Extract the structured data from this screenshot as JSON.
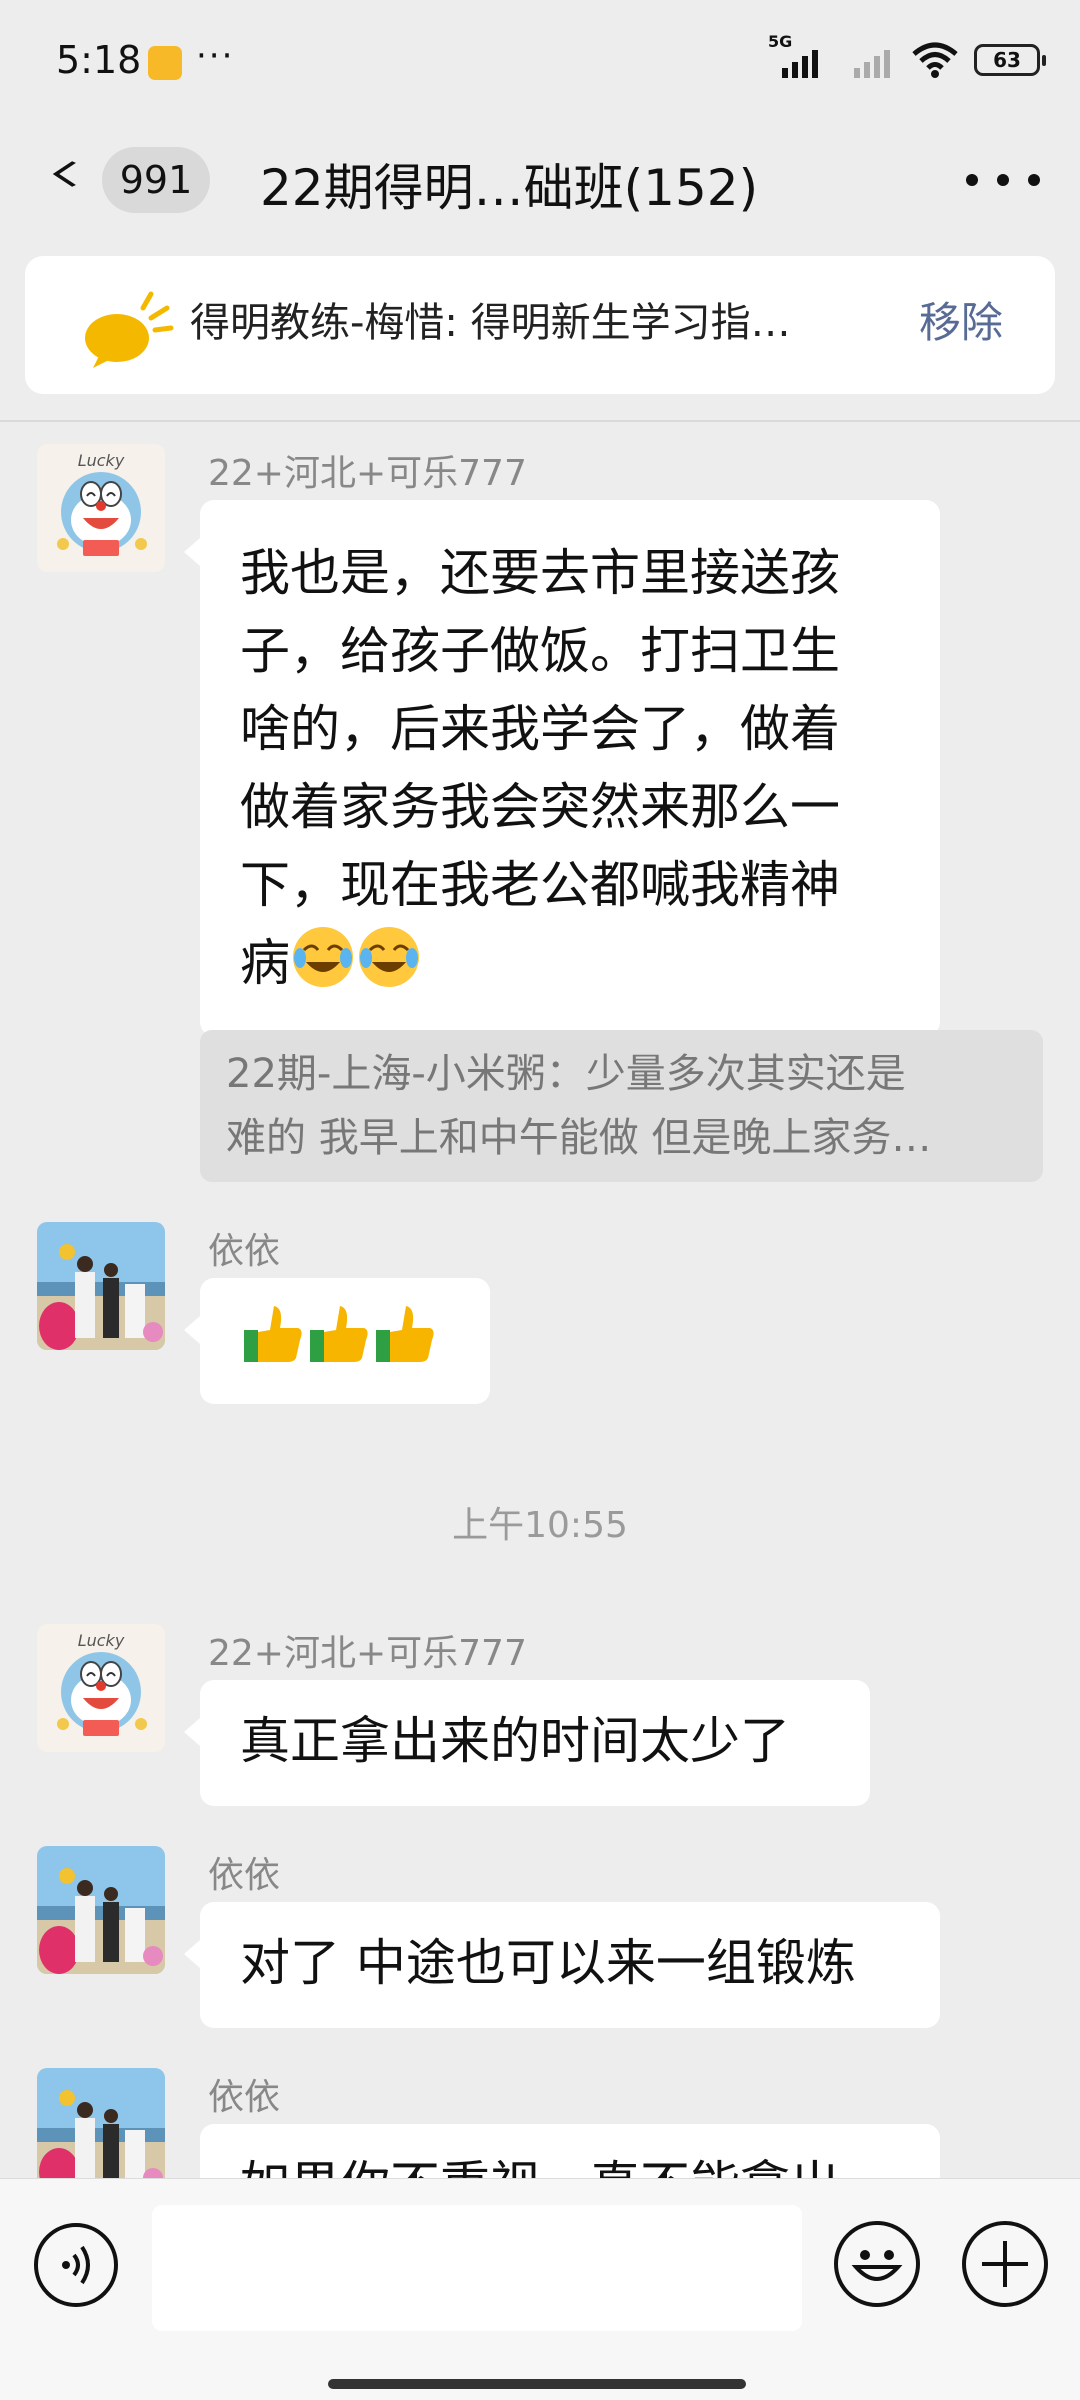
{
  "status_bar": {
    "time": "5:18",
    "more": "···",
    "network": "5G",
    "battery": "63"
  },
  "nav": {
    "badge": "991",
    "title": "22期得明…础班(152)"
  },
  "notice": {
    "text": "得明教练-梅惜: 得明新生学习指…",
    "remove": "移除"
  },
  "messages": [
    {
      "sender": "22+河北+可乐777",
      "lines": [
        "我也是，还要去市里接送孩",
        "子，给孩子做饭。打扫卫生",
        "啥的，后来我学会了，做着",
        "做着家务我会突然来那么一",
        "下，现在我老公都喊我精神",
        "病"
      ]
    },
    {
      "quote": [
        "22期-上海-小米粥：少量多次其实还是",
        "难的 我早上和中午能做 但是晚上家务…"
      ]
    },
    {
      "sender": "依依",
      "text": ""
    },
    {
      "time": "上午10:55"
    },
    {
      "sender": "22+河北+可乐777",
      "text": "真正拿出来的时间太少了"
    },
    {
      "sender": "依依",
      "text": "对了 中途也可以来一组锻炼"
    },
    {
      "sender": "依依",
      "text": "如果你不重视，真不能拿出"
    }
  ],
  "colors": {
    "background": "#EDEDED",
    "bubble": "#FFFFFF",
    "link": "#576B95",
    "quote_bg": "#DFDFDF"
  },
  "icons": [
    "back-icon",
    "more-icon",
    "notice-speaker-icon",
    "voice-icon",
    "emoji-icon",
    "plus-icon",
    "thumbs-up-emoji",
    "laugh-cry-emoji"
  ]
}
